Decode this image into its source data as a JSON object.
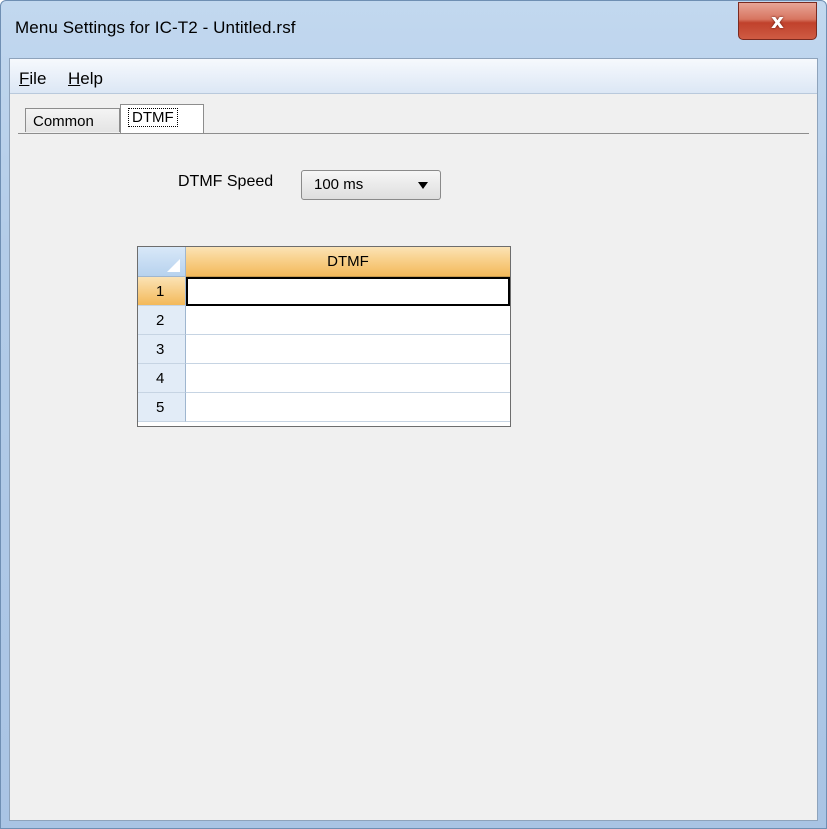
{
  "window": {
    "title": "Menu Settings for IC-T2 - Untitled.rsf",
    "close_label": "x"
  },
  "menu": {
    "file": {
      "accel": "F",
      "rest": "ile"
    },
    "help": {
      "accel": "H",
      "rest": "elp"
    }
  },
  "tabs": [
    {
      "label": "Common",
      "selected": false
    },
    {
      "label": "DTMF",
      "selected": true
    }
  ],
  "dtmf": {
    "speed_label": "DTMF Speed",
    "speed_value": "100 ms",
    "grid": {
      "column_header": "DTMF",
      "rows": [
        {
          "number": "1",
          "value": "",
          "active": true
        },
        {
          "number": "2",
          "value": ""
        },
        {
          "number": "3",
          "value": ""
        },
        {
          "number": "4",
          "value": ""
        },
        {
          "number": "5",
          "value": ""
        }
      ]
    }
  },
  "colors": {
    "title_gradient": "#b3cce8",
    "close_button": "#c0412c",
    "header_orange": "#f3b95a",
    "corner_blue": "#b7d2ee",
    "client_bg": "#f0f0f0"
  }
}
